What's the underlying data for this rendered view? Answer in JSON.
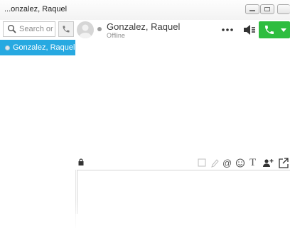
{
  "window": {
    "title": "...onzalez, Raquel"
  },
  "sidebar": {
    "search_placeholder": "Search or c",
    "contacts": [
      {
        "name": "Gonzalez, Raquel",
        "selected": true
      }
    ]
  },
  "header": {
    "contact_name": "Gonzalez, Raquel",
    "status": "Offline"
  },
  "toolbar": {
    "icons": [
      "lock-icon",
      "square-icon",
      "pencil-icon",
      "at-icon",
      "smiley-icon",
      "text-format-icon",
      "add-person-icon",
      "popout-icon"
    ],
    "mention_glyph": "@",
    "text_glyph": "T"
  },
  "colors": {
    "accent_blue": "#27a9e1",
    "call_green": "#2ebd3f",
    "offline_gray": "#9d9d9d"
  }
}
